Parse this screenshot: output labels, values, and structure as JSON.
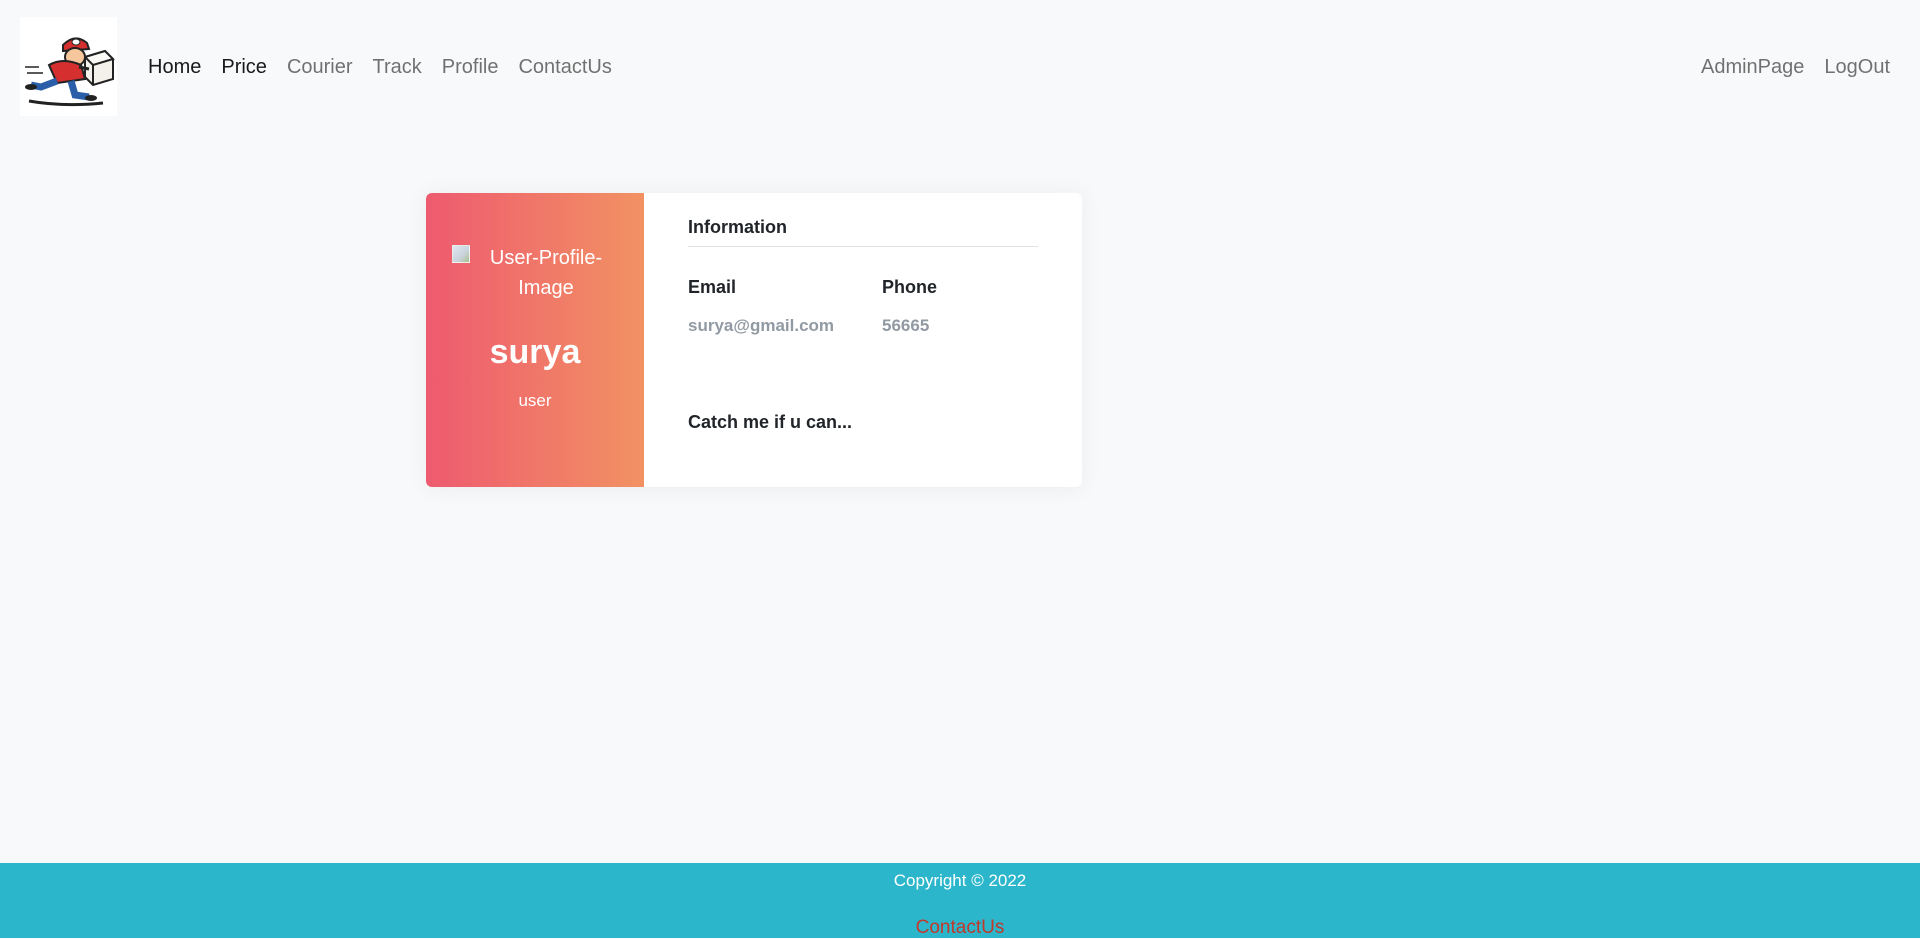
{
  "nav": {
    "logo_alt": "courier mascot logo",
    "links": [
      "Home",
      "Price",
      "Courier",
      "Track",
      "Profile",
      "ContactUs"
    ],
    "right_links": [
      "AdminPage",
      "LogOut"
    ]
  },
  "profile": {
    "image_alt": "User-Profile-Image",
    "name": "surya",
    "role": "user",
    "info_heading": "Information",
    "email_label": "Email",
    "email_value": "surya@gmail.com",
    "phone_label": "Phone",
    "phone_value": "56665",
    "bio": "Catch me if u can..."
  },
  "footer": {
    "copyright": "Copyright © 2022",
    "link": "ContactUs"
  },
  "colors": {
    "gradient_start": "#ee5a6f",
    "gradient_end": "#f29263",
    "footer_bg": "#2bb6cb",
    "footer_link": "#c0392b"
  }
}
